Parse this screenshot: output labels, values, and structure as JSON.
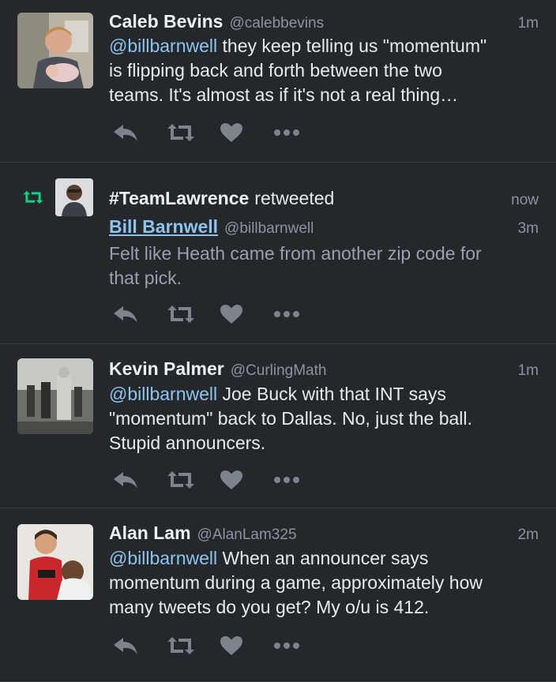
{
  "tweets": [
    {
      "name": "Caleb Bevins",
      "handle": "@calebbevins",
      "time": "1m",
      "mention": "@billbarnwell",
      "lines": [
        " they keep telling us \"momentum\"",
        "is flipping back and forth between the two",
        "teams. It's almost as if it's not a real thing…"
      ]
    },
    {
      "retweeter": "#TeamLawrence",
      "retweeted_label": "retweeted",
      "rt_time": "now",
      "name": "Bill Barnwell",
      "handle": "@billbarnwell",
      "time": "3m",
      "lines": [
        "Felt like Heath came from another zip code for",
        "that pick."
      ]
    },
    {
      "name": "Kevin Palmer",
      "handle": "@CurlingMath",
      "time": "1m",
      "mention": "@billbarnwell",
      "lines": [
        " Joe Buck with that INT says",
        "\"momentum\" back to Dallas.  No, just the ball.",
        "Stupid announcers."
      ]
    },
    {
      "name": "Alan Lam",
      "handle": "@AlanLam325",
      "time": "2m",
      "mention": "@billbarnwell",
      "lines": [
        " When an announcer says",
        "momentum during a game, approximately how",
        "many tweets do you get? My o/u is 412."
      ]
    }
  ],
  "icons": {
    "reply": "reply-arrow-icon",
    "retweet": "retweet-icon",
    "like": "heart-icon",
    "more": "more-dots-icon"
  },
  "colors": {
    "background": "#24272b",
    "mention": "#8ec3ee",
    "retweet_green": "#19cf86",
    "muted": "#8d949c"
  }
}
